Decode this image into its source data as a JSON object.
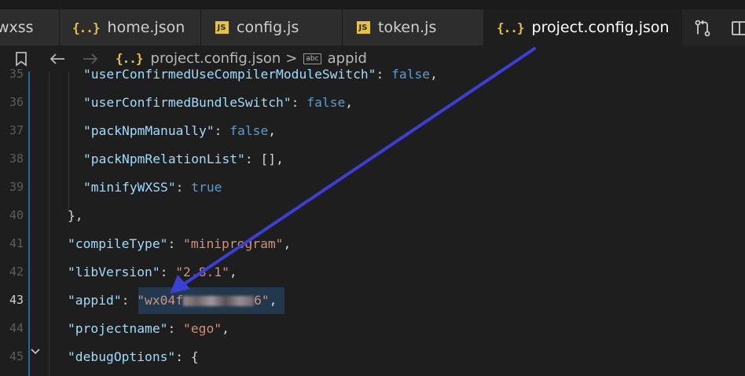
{
  "tabs": [
    {
      "label": "wxss",
      "icon": "none"
    },
    {
      "label": "home.json",
      "icon": "json-icon"
    },
    {
      "label": "config.js",
      "icon": "js-icon"
    },
    {
      "label": "token.js",
      "icon": "js-icon"
    },
    {
      "label": "project.config.json",
      "icon": "json-icon",
      "active": true
    }
  ],
  "icons": {
    "json": "{..}",
    "js": "JS",
    "close": "✕",
    "abc": "abc"
  },
  "breadcrumb": {
    "file": "project.config.json",
    "separator": ">",
    "symbol": "appid"
  },
  "editor": {
    "current_line": 43,
    "lines": [
      {
        "n": "35",
        "key": "\"userConfirmedUseCompilerModuleSwitch\"",
        "sep": ": ",
        "val": "false",
        "tail": ","
      },
      {
        "n": "36",
        "key": "\"userConfirmedBundleSwitch\"",
        "sep": ": ",
        "val": "false",
        "tail": ","
      },
      {
        "n": "37",
        "key": "\"packNpmManually\"",
        "sep": ": ",
        "val": "false",
        "tail": ","
      },
      {
        "n": "38",
        "key": "\"packNpmRelationList\"",
        "sep": ": ",
        "val": "[]",
        "tail": ","
      },
      {
        "n": "39",
        "key": "\"minifyWXSS\"",
        "sep": ": ",
        "val": "true",
        "tail": ""
      },
      {
        "n": "40",
        "key": "",
        "sep": "",
        "val": "},",
        "tail": ""
      },
      {
        "n": "41",
        "key": "\"compileType\"",
        "sep": ": ",
        "val": "\"miniprogram\"",
        "tail": ","
      },
      {
        "n": "42",
        "key": "\"libVersion\"",
        "sep": ": ",
        "val": "\"2.8.1\"",
        "tail": ","
      },
      {
        "n": "43",
        "key": "\"appid\"",
        "sep": ": ",
        "val_prefix": "\"wx04f",
        "val_suffix": "6\"",
        "tail": ","
      },
      {
        "n": "44",
        "key": "\"projectname\"",
        "sep": ": ",
        "val": "\"ego\"",
        "tail": ","
      },
      {
        "n": "45",
        "key": "\"debugOptions\"",
        "sep": ": ",
        "val": "{",
        "tail": ""
      }
    ]
  },
  "colors": {
    "arrow": "#3a3fd6",
    "key": "#9cdcfe",
    "string": "#ce9178",
    "keyword": "#569cd6"
  }
}
